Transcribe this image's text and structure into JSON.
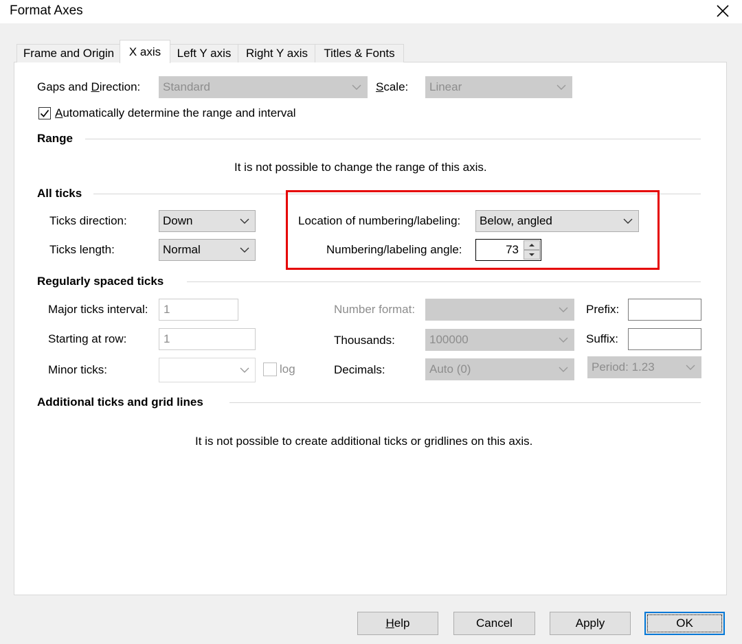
{
  "window": {
    "title": "Format Axes"
  },
  "tabs": [
    {
      "label": "Frame and Origin"
    },
    {
      "label": "X axis"
    },
    {
      "label": "Left Y axis"
    },
    {
      "label": "Right Y axis"
    },
    {
      "label": "Titles & Fonts"
    }
  ],
  "top": {
    "gaps_label_pre": "Gaps and ",
    "gaps_label_key": "D",
    "gaps_label_post": "irection:",
    "gaps_value": "Standard",
    "scale_label_key": "S",
    "scale_label_post": "cale:",
    "scale_value": "Linear",
    "auto_key": "A",
    "auto_label_post": "utomatically determine the range and interval"
  },
  "range": {
    "heading": "Range",
    "message": "It is not possible to change the range of this axis."
  },
  "all_ticks": {
    "heading": "All ticks",
    "direction_label": "Ticks direction:",
    "direction_value": "Down",
    "length_label": "Ticks length:",
    "length_value": "Normal",
    "location_label": "Location of numbering/labeling:",
    "location_value": "Below, angled",
    "angle_label": "Numbering/labeling angle:",
    "angle_value": "73"
  },
  "regular": {
    "heading": "Regularly spaced ticks",
    "major_label": "Major ticks interval:",
    "major_value": "1",
    "start_label": "Starting at row:",
    "start_value": "1",
    "minor_label": "Minor ticks:",
    "log_label": "log",
    "numformat_label": "Number format:",
    "thousands_label": "Thousands:",
    "thousands_value": "100000",
    "decimals_label": "Decimals:",
    "decimals_value": "Auto (0)",
    "prefix_label": "Prefix:",
    "suffix_label": "Suffix:",
    "period_value": "Period: 1.23"
  },
  "additional": {
    "heading": "Additional ticks and grid lines",
    "message": "It is not possible to create additional ticks or gridlines on this axis."
  },
  "buttons": {
    "help_key": "H",
    "help_post": "elp",
    "cancel": "Cancel",
    "apply": "Apply",
    "ok": "OK"
  }
}
